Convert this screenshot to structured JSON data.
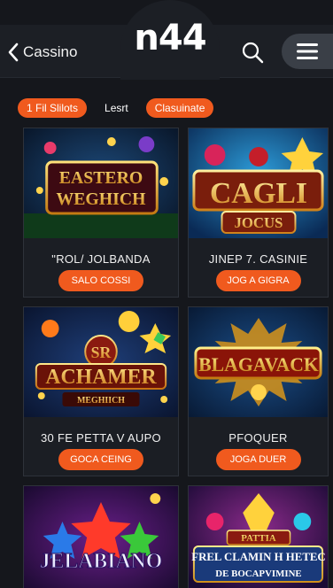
{
  "header": {
    "logo": "n44",
    "back_label": "Cassino",
    "search_icon": "search-icon",
    "menu_icon": "hamburger-icon"
  },
  "filters": [
    {
      "label": "1 Fil Slilots",
      "active": true
    },
    {
      "label": "Lesrt",
      "active": false
    },
    {
      "label": "Clasuinate",
      "active": true
    }
  ],
  "games": [
    {
      "art_line1": "EASTERO",
      "art_line2": "WEGHICH",
      "title": "\"ROL/ JOLBANDA",
      "button": "SALO COSSI"
    },
    {
      "art_line1": "CAGLI",
      "art_line2": "JOCUS",
      "title": "JINEP 7. CASINIE",
      "button": "JOG A GIGRA"
    },
    {
      "art_line1": "SR",
      "art_line2": "ACHAMER",
      "art_line3": "MEGHIICH",
      "title": "30 FE PETTA V AUPO",
      "button": "GOCA CEING"
    },
    {
      "art_line1": "BLAGAVACK",
      "title": "PFOQUER",
      "button": "JOGA DUER"
    },
    {
      "art_line1": "JELABIANO"
    },
    {
      "art_line1": "PATTIA",
      "art_line2": "FREL CLAMIN H HETEC",
      "art_line3": "DE BOCAPVIMINE"
    }
  ],
  "colors": {
    "accent": "#f05a1e",
    "background": "#15171c",
    "header": "#1c1f25"
  }
}
